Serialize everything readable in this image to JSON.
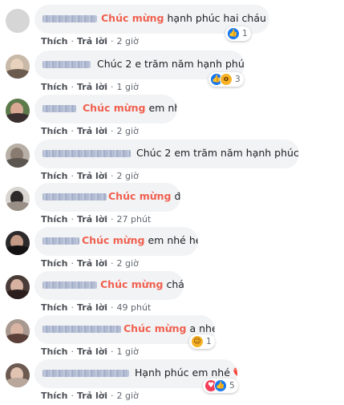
{
  "common": {
    "like": "Thích",
    "reply": "Trả lời",
    "sep": "·"
  },
  "comments": [
    {
      "highlight": "Chúc mừng",
      "text": " hạnh phúc hai cháu nhé",
      "time": "2 giờ",
      "reactions": {
        "icons": [
          "like-icon"
        ],
        "count": "1"
      }
    },
    {
      "highlight": "",
      "text": "Chúc 2 e trăm năm hạnh phúc",
      "emoji": "‼️",
      "time": "1 giờ",
      "reactions": {
        "icons": [
          "like-icon",
          "wow-icon"
        ],
        "count": "3"
      }
    },
    {
      "highlight": "Chúc mừng",
      "text": " em nhé",
      "time": "2 giờ"
    },
    {
      "highlight": "",
      "text": "Chúc 2 em trăm năm hạnh phúc nhé.",
      "time": "2 giờ"
    },
    {
      "highlight": "Chúc mừng",
      "text": " đ/c",
      "time": "27 phút"
    },
    {
      "highlight": "Chúc mừng",
      "text": " em nhé hehe",
      "time": "2 giờ"
    },
    {
      "highlight": "Chúc mừng",
      "text": " cháu.",
      "time": "49 phút"
    },
    {
      "highlight": "Chúc mừng",
      "text": " a nhé.",
      "time": "1 giờ",
      "reactions": {
        "icons": [
          "haha-icon"
        ],
        "count": "1"
      }
    },
    {
      "highlight": "",
      "text": "Hạnh phúc em nhé",
      "emoji": "❤️",
      "time": "2 giờ",
      "reactions": {
        "icons": [
          "heart-icon",
          "like-icon"
        ],
        "count": "5"
      }
    }
  ],
  "colors": {
    "highlight": "#f0604f",
    "bubble": "#f2f3f5",
    "meta": "#606770",
    "like": "#1877f2",
    "heart": "#f33e58",
    "wow": "#f7b125"
  }
}
